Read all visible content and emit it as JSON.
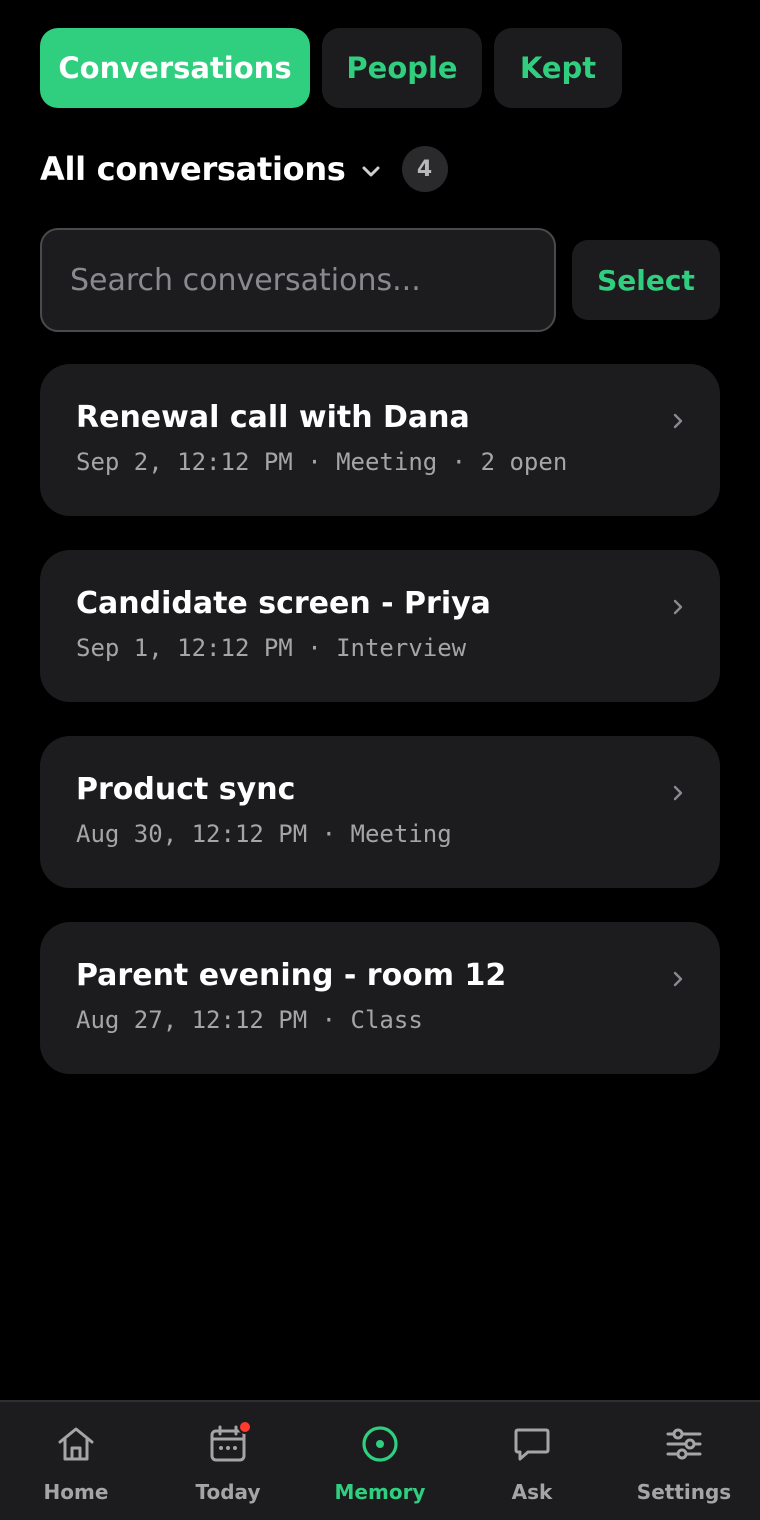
{
  "tabs": [
    {
      "label": "Conversations",
      "active": true
    },
    {
      "label": "People",
      "active": false
    },
    {
      "label": "Kept",
      "active": false
    }
  ],
  "filter": {
    "title": "All conversations",
    "count": "4"
  },
  "search": {
    "placeholder": "Search conversations...",
    "value": ""
  },
  "select_label": "Select",
  "conversations": [
    {
      "title": "Renewal call with Dana",
      "meta": "Sep 2, 12:12 PM · Meeting · 2 open"
    },
    {
      "title": "Candidate screen - Priya",
      "meta": "Sep 1, 12:12 PM · Interview"
    },
    {
      "title": "Product sync",
      "meta": "Aug 30, 12:12 PM · Meeting"
    },
    {
      "title": "Parent evening - room 12",
      "meta": "Aug 27, 12:12 PM · Class"
    }
  ],
  "nav": [
    {
      "label": "Home",
      "icon": "home-icon"
    },
    {
      "label": "Today",
      "icon": "calendar-icon",
      "notification": true
    },
    {
      "label": "Memory",
      "icon": "memory-icon",
      "active": true
    },
    {
      "label": "Ask",
      "icon": "chat-bubble-icon"
    },
    {
      "label": "Settings",
      "icon": "sliders-icon"
    }
  ],
  "colors": {
    "accent": "#2fcf7f",
    "background": "#000000",
    "surface": "#1c1c1e",
    "notification": "#ff3b30"
  }
}
